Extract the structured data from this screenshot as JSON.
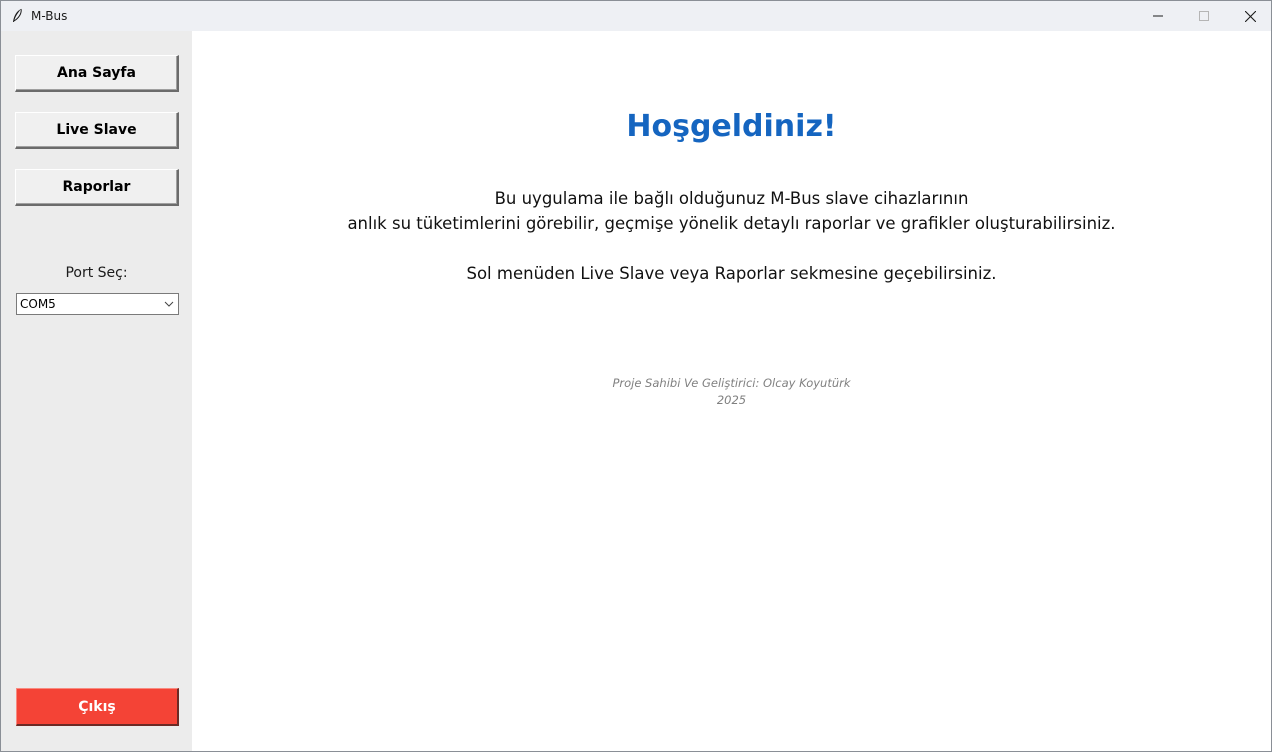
{
  "window": {
    "title": "M-Bus"
  },
  "sidebar": {
    "nav": [
      {
        "label": "Ana Sayfa"
      },
      {
        "label": "Live Slave"
      },
      {
        "label": "Raporlar"
      }
    ],
    "port_label": "Port Seç:",
    "port_selected": "COM5",
    "exit_label": "Çıkış"
  },
  "main": {
    "title": "Hoşgeldiniz!",
    "description_line1": "Bu uygulama ile bağlı olduğunuz M-Bus slave cihazlarının",
    "description_line2": "anlık su tüketimlerini görebilir, geçmişe yönelik detaylı raporlar ve grafikler oluşturabilirsiniz.",
    "description_line3": "Sol menüden Live Slave veya Raporlar sekmesine geçebilirsiniz.",
    "credit_line1": "Proje Sahibi Ve Geliştirici: Olcay Koyutürk",
    "credit_line2": "2025"
  },
  "colors": {
    "accent_title": "#1565c0",
    "exit_button": "#f44336",
    "sidebar_bg": "#ececec",
    "content_bg": "#ffffff"
  },
  "icons": {
    "app": "feather-icon",
    "minimize": "minimize-icon",
    "maximize": "maximize-icon",
    "close": "close-icon",
    "dropdown": "chevron-down-icon"
  }
}
